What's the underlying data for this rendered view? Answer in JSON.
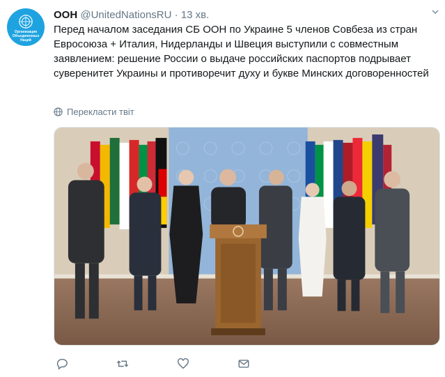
{
  "account": {
    "name": "ООН",
    "handle": "@UnitedNationsRU",
    "dot": "·",
    "time": "13 хв.",
    "avatar_text": "Организация\nОбъединенных\nНаций"
  },
  "tweet": {
    "text": "Перед началом заседания СБ ООН по Украине 5 членов Совбеза из стран Евросоюза + Италия, Нидерланды и Швеция выступили с совместным заявлением: решение России о выдаче российских паспортов подрывает суверенитет Украины и противоречит духу и букве Минских договоренностей",
    "translate_label": "Перекласти твіт"
  },
  "media": {
    "podium_emblem": "UN"
  },
  "icons": {
    "avatar": "un-emblem-icon",
    "menu": "chevron-down-icon",
    "translate": "globe-icon",
    "reply": "reply-icon",
    "retweet": "retweet-icon",
    "like": "heart-icon",
    "message": "envelope-icon"
  },
  "colors": {
    "accent": "#1da1f2",
    "muted": "#657786",
    "text": "#14171a"
  }
}
